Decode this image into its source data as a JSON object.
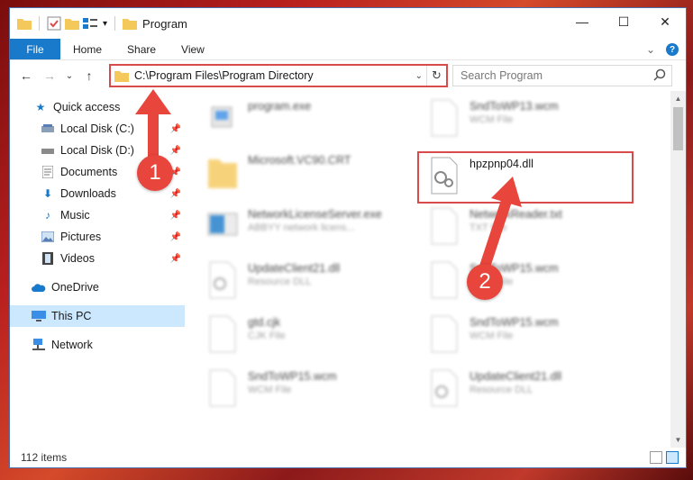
{
  "window": {
    "title": "Program",
    "controls": {
      "minimize": "—",
      "maximize": "☐",
      "close": "✕"
    }
  },
  "ribbon": {
    "tabs": [
      "File",
      "Home",
      "Share",
      "View"
    ],
    "collapse": "⌄",
    "help": "?"
  },
  "nav": {
    "back": "←",
    "forward": "→",
    "recent": "⌄",
    "up": "↑",
    "address": "C:\\Program Files\\Program Directory",
    "address_dropdown": "⌄",
    "refresh": "↻",
    "search_placeholder": "Search Program"
  },
  "sidebar": {
    "quick_access": "Quick access",
    "items": [
      {
        "label": "Local Disk (C:)",
        "icon": "drive-icon"
      },
      {
        "label": "Local Disk (D:)",
        "icon": "drive-icon"
      },
      {
        "label": "Documents",
        "icon": "documents-icon"
      },
      {
        "label": "Downloads",
        "icon": "downloads-icon"
      },
      {
        "label": "Music",
        "icon": "music-icon"
      },
      {
        "label": "Pictures",
        "icon": "pictures-icon"
      },
      {
        "label": "Videos",
        "icon": "videos-icon"
      }
    ],
    "onedrive": "OneDrive",
    "this_pc": "This PC",
    "network": "Network"
  },
  "files": [
    {
      "name": "program.exe",
      "type": ""
    },
    {
      "name": "SndToWP13.wcm",
      "type": "WCM File"
    },
    {
      "name": "Microsoft.VC90.CRT",
      "type": ""
    },
    {
      "name": "hpzpnp04.dll",
      "type": ""
    },
    {
      "name": "NetworkLicenseServer.exe",
      "type": "ABBYY network licens..."
    },
    {
      "name": "NetworkReader.txt",
      "type": "TXT File"
    },
    {
      "name": "UpdateClient21.dll",
      "type": "Resource DLL"
    },
    {
      "name": "SndToWP15.wcm",
      "type": "WCM File"
    },
    {
      "name": "gtd.cjk",
      "type": "CJK File"
    },
    {
      "name": "SndToWP15.wcm",
      "type": "WCM File"
    },
    {
      "name": "SndToWP15.wcm",
      "type": "WCM File"
    },
    {
      "name": "UpdateClient21.dll",
      "type": "Resource DLL"
    }
  ],
  "annotations": {
    "marker1": "1",
    "marker2": "2"
  },
  "status": {
    "items_count": "112 items"
  },
  "colors": {
    "accent": "#1979ca",
    "highlight": "#d94b4b",
    "marker": "#e8453c"
  }
}
